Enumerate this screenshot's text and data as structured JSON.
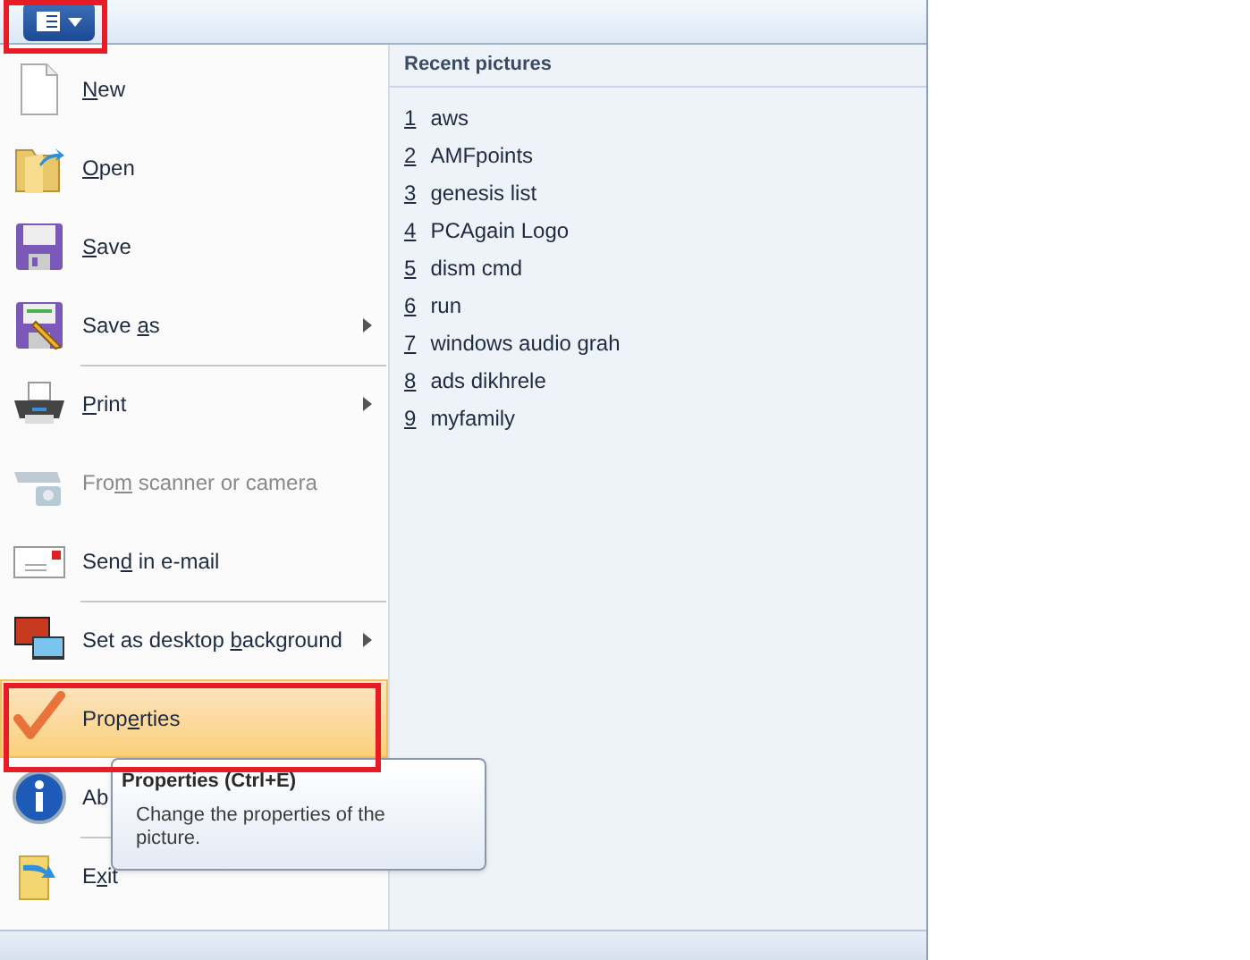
{
  "menu": {
    "items": [
      {
        "key": "N",
        "post": "ew",
        "submenu": false,
        "disabled": false,
        "selected": false,
        "divider_before": false
      },
      {
        "key": "O",
        "post": "pen",
        "submenu": false,
        "disabled": false,
        "selected": false,
        "divider_before": false
      },
      {
        "key": "S",
        "post": "ave",
        "submenu": false,
        "disabled": false,
        "selected": false,
        "divider_before": false
      },
      {
        "pre": "Save ",
        "key": "a",
        "post": "s",
        "submenu": true,
        "disabled": false,
        "selected": false,
        "divider_before": false
      },
      {
        "key": "P",
        "post": "rint",
        "submenu": true,
        "disabled": false,
        "selected": false,
        "divider_before": true
      },
      {
        "pre": "Fro",
        "key": "m",
        "post": " scanner or camera",
        "submenu": false,
        "disabled": true,
        "selected": false,
        "divider_before": false
      },
      {
        "pre": "Sen",
        "key": "d",
        "post": " in e-mail",
        "submenu": false,
        "disabled": false,
        "selected": false,
        "divider_before": false
      },
      {
        "pre": "Set as desktop ",
        "key": "b",
        "post": "ackground",
        "submenu": true,
        "disabled": false,
        "selected": false,
        "divider_before": true
      },
      {
        "pre": "Prop",
        "key": "e",
        "post": "rties",
        "submenu": false,
        "disabled": false,
        "selected": true,
        "divider_before": false
      },
      {
        "pre": "Ab",
        "disabled": false,
        "selected": false,
        "divider_before": false
      },
      {
        "pre": "E",
        "key": "x",
        "post": "it",
        "submenu": false,
        "disabled": false,
        "selected": false,
        "divider_before": true
      }
    ]
  },
  "recent": {
    "title": "Recent pictures",
    "items": [
      {
        "number": "1",
        "name": "aws"
      },
      {
        "number": "2",
        "name": "AMFpoints"
      },
      {
        "number": "3",
        "name": "genesis list"
      },
      {
        "number": "4",
        "name": "PCAgain Logo"
      },
      {
        "number": "5",
        "name": "dism cmd"
      },
      {
        "number": "6",
        "name": "run"
      },
      {
        "number": "7",
        "name": "windows audio grah"
      },
      {
        "number": "8",
        "name": "ads dikhrele"
      },
      {
        "number": "9",
        "name": "myfamily"
      }
    ]
  },
  "tooltip": {
    "title": "Properties (Ctrl+E)",
    "text": "Change the properties of the picture."
  }
}
